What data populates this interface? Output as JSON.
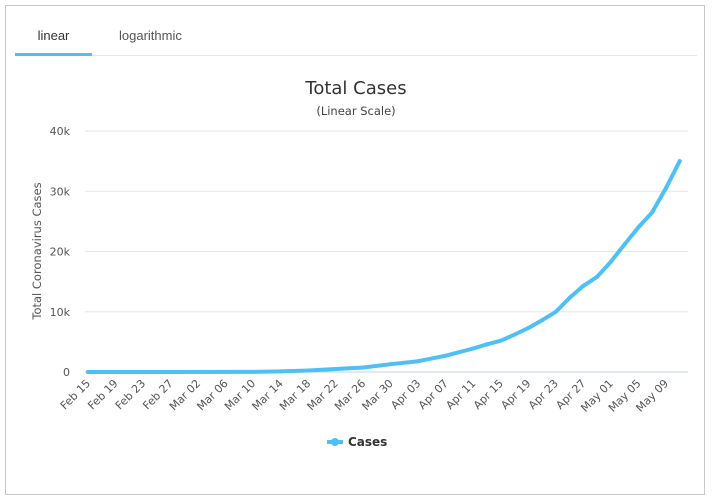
{
  "tabs": [
    {
      "label": "linear",
      "active": true
    },
    {
      "label": "logarithmic",
      "active": false
    }
  ],
  "chart_data": {
    "type": "line",
    "title": "Total Cases",
    "subtitle": "(Linear Scale)",
    "xlabel": "",
    "ylabel": "Total Coronavirus Cases",
    "ylim": [
      0,
      40000
    ],
    "yticks": [
      0,
      10000,
      20000,
      30000,
      40000
    ],
    "ytick_labels": [
      "0",
      "10k",
      "20k",
      "30k",
      "40k"
    ],
    "xtick_labels": [
      "Feb 15",
      "Feb 19",
      "Feb 23",
      "Feb 27",
      "Mar 02",
      "Mar 06",
      "Mar 10",
      "Mar 14",
      "Mar 18",
      "Mar 22",
      "Mar 26",
      "Mar 30",
      "Apr 03",
      "Apr 07",
      "Apr 11",
      "Apr 15",
      "Apr 19",
      "Apr 23",
      "Apr 27",
      "May 01",
      "May 05",
      "May 09"
    ],
    "grid": true,
    "legend": "bottom-center",
    "series": [
      {
        "name": "Cases",
        "color": "#4fc0f5",
        "points": [
          {
            "x": "Feb 15",
            "y": 0
          },
          {
            "x": "Feb 27",
            "y": 0
          },
          {
            "x": "Mar 10",
            "y": 20
          },
          {
            "x": "Mar 14",
            "y": 100
          },
          {
            "x": "Mar 18",
            "y": 250
          },
          {
            "x": "Mar 22",
            "y": 500
          },
          {
            "x": "Mar 26",
            "y": 750
          },
          {
            "x": "Mar 30",
            "y": 1300
          },
          {
            "x": "Apr 03",
            "y": 1800
          },
          {
            "x": "Apr 07",
            "y": 2700
          },
          {
            "x": "Apr 09",
            "y": 3300
          },
          {
            "x": "Apr 11",
            "y": 3900
          },
          {
            "x": "Apr 13",
            "y": 4600
          },
          {
            "x": "Apr 15",
            "y": 5200
          },
          {
            "x": "Apr 17",
            "y": 6200
          },
          {
            "x": "Apr 19",
            "y": 7300
          },
          {
            "x": "Apr 21",
            "y": 8600
          },
          {
            "x": "Apr 23",
            "y": 10000
          },
          {
            "x": "Apr 25",
            "y": 12300
          },
          {
            "x": "Apr 27",
            "y": 14300
          },
          {
            "x": "Apr 29",
            "y": 15800
          },
          {
            "x": "May 01",
            "y": 18300
          },
          {
            "x": "May 03",
            "y": 21200
          },
          {
            "x": "May 05",
            "y": 24000
          },
          {
            "x": "May 07",
            "y": 26500
          },
          {
            "x": "May 09",
            "y": 30500
          },
          {
            "x": "May 11",
            "y": 35000
          }
        ]
      }
    ]
  }
}
